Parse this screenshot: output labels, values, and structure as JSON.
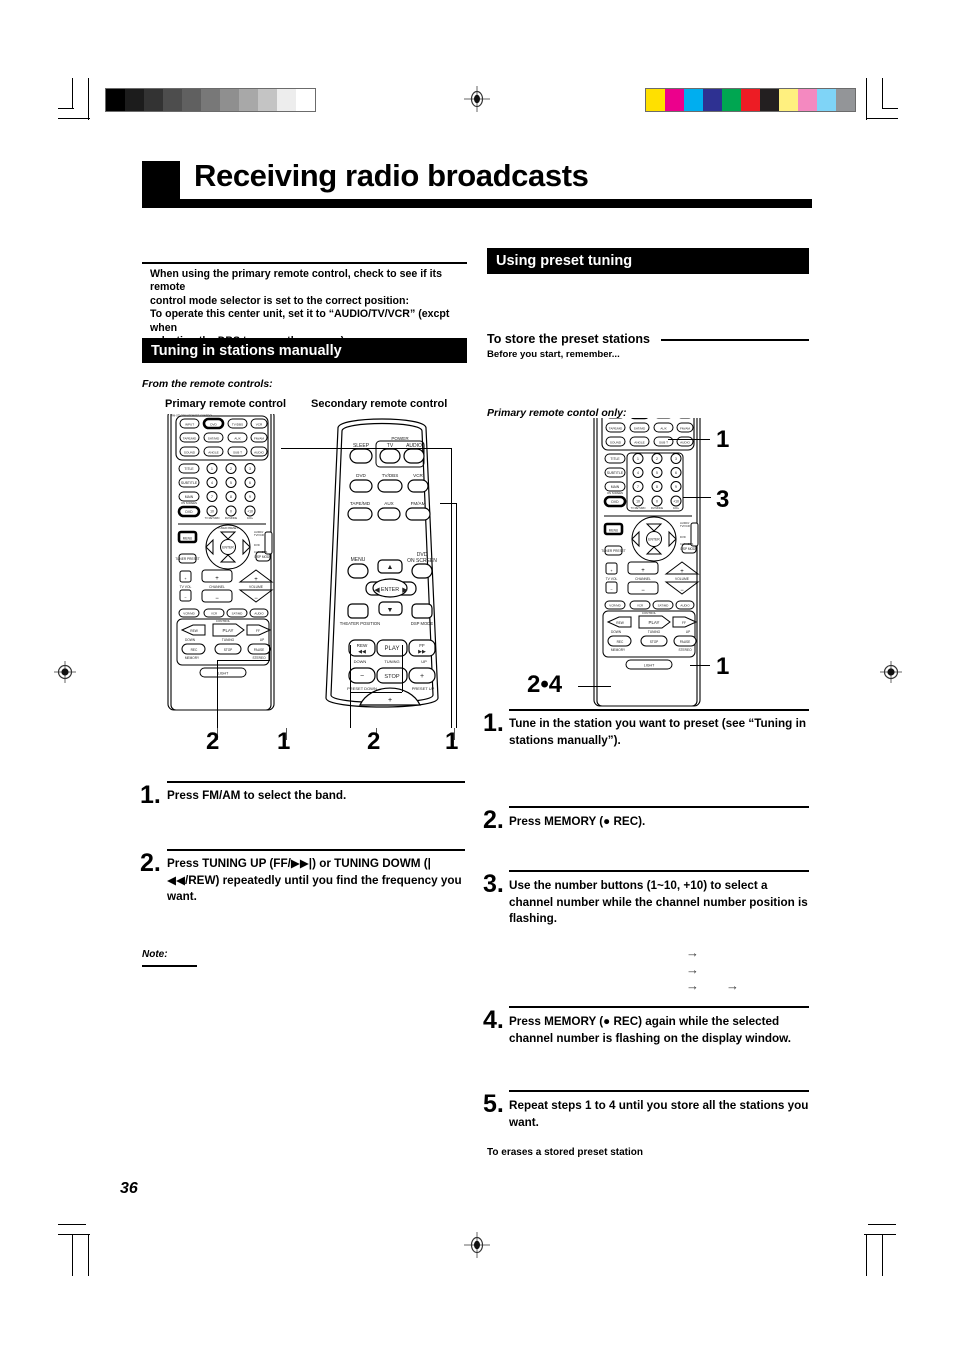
{
  "page": {
    "number": "36",
    "title": "Receiving radio broadcasts"
  },
  "printer_marks": {
    "grayscale_bar": [
      "#000000",
      "#1c1c1c",
      "#333333",
      "#4d4d4d",
      "#606060",
      "#787878",
      "#8f8f8f",
      "#a8a8a8",
      "#c4c4c4",
      "#ededed",
      "#ffffff"
    ],
    "color_bar": [
      "#ffe000",
      "#ec008c",
      "#00aeef",
      "#2e3192",
      "#00a651",
      "#ed1c24",
      "#231f20",
      "#fff07f",
      "#f489c0",
      "#7fd4f7",
      "#939598"
    ]
  },
  "intro": {
    "line1": "When using the primary remote control, check to see if its remote",
    "line2": "control mode selector is set to the correct position:",
    "line3": "To operate this center unit, set it to “AUDIO/TV/VCR” (excpt when",
    "line4": "selecting the DBS tuner as the source)."
  },
  "left_column": {
    "section_heading": "Tuning in stations manually",
    "from_label": "From the remote controls:",
    "remote_labels": {
      "primary": "Primary remote control",
      "secondary": "Secondary remote control"
    },
    "callouts": [
      "2",
      "1",
      "2",
      "1"
    ],
    "steps": [
      {
        "number": "1.",
        "text": "Press FM/AM to select the band."
      },
      {
        "number": "2.",
        "text": "Press TUNING UP (FF/▶▶|) or TUNING DOWM (|◀◀/REW) repeatedly until you find the frequency you want."
      }
    ],
    "note_label": "Note:"
  },
  "right_column": {
    "section_heading": "Using preset tuning",
    "subhead": "To store the preset stations",
    "subcap": "Before you start, remember...",
    "remote_label": "Primary remote contol only:",
    "callouts": [
      "1",
      "3",
      "1",
      "2•4"
    ],
    "steps": [
      {
        "number": "1.",
        "text": "Tune in the station you want to preset (see “Tuning in stations manually”)."
      },
      {
        "number": "2.",
        "text": "Press MEMORY (● REC)."
      },
      {
        "number": "3.",
        "text": "Use the number buttons (1~10, +10) to select a channel number while the channel number position is flashing."
      },
      {
        "number": "4.",
        "text": "Press MEMORY (● REC) again while the selected channel number is flashing on the display window."
      },
      {
        "number": "5.",
        "text": "Repeat steps 1 to 4 until you store all the stations you want."
      }
    ],
    "footer_note": "To erases a stored preset station",
    "faded_arrows": [
      "→",
      "→",
      "→",
      "→"
    ]
  },
  "remote_primary": {
    "source_buttons": [
      "INPUT",
      "DVD",
      "TV/DBS",
      "VCR",
      "TAPE/MD",
      "SAT/MD",
      "AUX",
      "FM/AM",
      "SOUND",
      "ANGLE",
      "SUB T",
      "AUDIO"
    ],
    "number_buttons": [
      "1",
      "2",
      "3",
      "4",
      "5",
      "6",
      "7",
      "8",
      "9",
      "10",
      "0",
      "+10"
    ],
    "left_buttons": [
      "TITLE",
      "SUBTITLE",
      "MAIN",
      "DVD"
    ],
    "number_captions": [
      "TV RETURN",
      "FM MODE",
      "100+"
    ],
    "nav": {
      "enter": "ENTER",
      "menu": "MENU"
    },
    "volume": {
      "tv_vol": "TV VOL",
      "channel": "CHANNEL",
      "volume": "VOLUME"
    },
    "mode_buttons": [
      "VCR",
      "VCR",
      "SAT/MD",
      "AUDIO"
    ],
    "control_label": "CONTROL",
    "transport": {
      "rew": "REW",
      "play": "PLAY",
      "ff": "FF",
      "rec": "REC",
      "stop": "STOP",
      "pause": "PAUSE"
    },
    "transport_captions": {
      "down": "DOWN",
      "tuning": "TUNING",
      "up": "UP",
      "memory": "MEMORY",
      "stereo": "STEREO"
    },
    "light_button": "LIGHT",
    "side_labels": [
      "AUDIO/ TV/VCR",
      "DVD",
      "CATV/DBS"
    ]
  },
  "remote_secondary": {
    "power_label": "POWER",
    "top_buttons": [
      "SLEEP",
      "TV",
      "AUDIO"
    ],
    "source_buttons": [
      "DVD",
      "TV/DBS",
      "VCR",
      "TAPE/MD",
      "AUX",
      "FM/AM"
    ],
    "nav": {
      "menu": "MENU",
      "dvd_on_screen": "DVD ON SCREEN",
      "enter": "ENTER"
    },
    "bottom_labels": [
      "THEATER POSITION",
      "DSP MODE"
    ],
    "transport": {
      "rew": "REW",
      "play": "PLAY",
      "ff": "FF",
      "stop": "STOP"
    },
    "transport_captions": {
      "down": "DOWN",
      "tuning": "TUNING",
      "up": "UP",
      "preset_down": "PRESET DOWN",
      "preset_up": "PRESET UP"
    }
  }
}
